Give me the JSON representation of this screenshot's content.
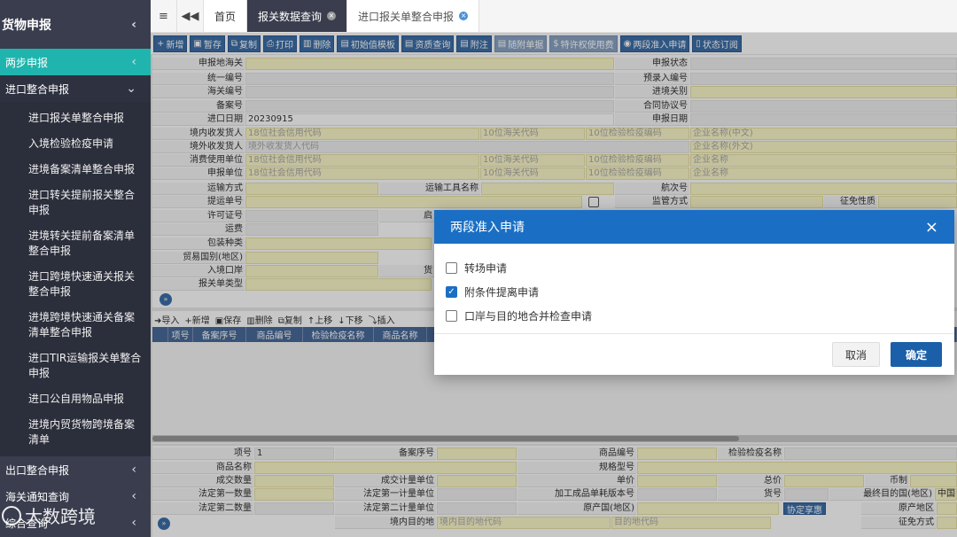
{
  "sidebar": {
    "title": "货物申报",
    "active": "两步申报",
    "open_group": "进口整合申报",
    "items": [
      "进口报关单整合申报",
      "入境检验检疫申请",
      "进境备案清单整合申报",
      "进口转关提前报关整合申报",
      "进境转关提前备案清单整合申报",
      "进口跨境快速通关报关整合申报",
      "进境跨境快速通关备案清单整合申报",
      "进口TIR运输报关单整合申报",
      "进口公自用物品申报",
      "进境内贸货物跨境备案清单"
    ],
    "bottom_groups": [
      "出口整合申报",
      "海关通知查询",
      "综合查询"
    ]
  },
  "watermark": "大数跨境",
  "tabs": {
    "home": "首页",
    "tab1": "报关数据查询",
    "tab2": "进口报关单整合申报"
  },
  "toolbar": [
    "新增",
    "暂存",
    "复制",
    "打印",
    "删除",
    "初始值模板",
    "资质查询",
    "附注",
    "随附单据",
    "特许权使用费",
    "两段准入申请",
    "状态订阅"
  ],
  "form": {
    "shenbaodi_haiguan": "申报地海关",
    "shenbao_zhuangtai": "申报状态",
    "tongyi_bianhao": "统一编号",
    "yulu_bianhao": "预录入编号",
    "haiguan_bianhao": "海关编号",
    "jinjing_guanbie": "进境关别",
    "beian_hao": "备案号",
    "hetong_xieyi_hao": "合同协议号",
    "jinkou_riqi": "进口日期",
    "jinkou_riqi_value": "20230915",
    "shenbao_riqi": "申报日期",
    "jingnei_shoufahuoren": "境内收发货人",
    "jingwai_shoufahuoren": "境外收发货人",
    "xiaofei_shiyong_danwei": "消费使用单位",
    "shenbao_danwei": "申报单位",
    "ph_credit": "18位社会信用代码",
    "ph_customs": "10位海关代码",
    "ph_ciq": "10位检验检疫编码",
    "ph_name_cn": "企业名称(中文)",
    "ph_foreign_code": "境外收发货人代码",
    "ph_name_en": "企业名称(外文)",
    "ph_name": "企业名称",
    "yunshu_fangshi": "运输方式",
    "yunshu_gongju_mingcheng": "运输工具名称",
    "hangci_hao": "航次号",
    "tiyun_danhao": "提运单号",
    "jianguan_fangshi": "监管方式",
    "zhengmian_xingzhi": "征免性质",
    "xuke_zhenghao": "许可证号",
    "qiyun": "启",
    "yunfei": "运费",
    "baozhuang_zhonglei": "包装种类",
    "maoyi_guobie": "贸易国别(地区)",
    "rujing_kouan": "入境口岸",
    "huo": "货",
    "baoguandan_leixing": "报关单类型"
  },
  "goods": {
    "toolbar": [
      "导入",
      "新增",
      "保存",
      "删除",
      "复制",
      "上移",
      "下移",
      "插入"
    ],
    "columns": [
      "项号",
      "备案序号",
      "商品编号",
      "检验检疫名称",
      "商品名称"
    ]
  },
  "item": {
    "xianghao": "项号",
    "xianghao_value": "1",
    "beian_xuhao": "备案序号",
    "shangpin_bianhao": "商品编号",
    "jianyan_mingcheng": "检验检疫名称",
    "shangpin_mingcheng": "商品名称",
    "guige_xinghao": "规格型号",
    "chengjiao_shuliang": "成交数量",
    "chengjiao_danwei": "成交计量单位",
    "danjia": "单价",
    "zongjia": "总价",
    "bizhi": "币制",
    "fading_diyi_shuliang": "法定第一数量",
    "fading_diyi_danwei": "法定第一计量单位",
    "jiagong_banben": "加工成品单耗版本号",
    "huohao": "货号",
    "zuizhong_mudi_guo": "最终目的国(地区)",
    "zuizhong_value": "中国",
    "fading_dier_shuliang": "法定第二数量",
    "fading_dier_danwei": "法定第二计量单位",
    "yuanchan_guo": "原产国(地区)",
    "xieding_xiangshou": "协定享惠",
    "yuanchan_diqu": "原产地区",
    "jingnei_mudidi": "境内目的地",
    "ph_dest_code": "境内目的地代码",
    "ph_dest_name": "目的地代码",
    "zhengmian_fangshi": "征免方式"
  },
  "modal": {
    "title": "两段准入申请",
    "options": [
      {
        "label": "转场申请",
        "checked": false
      },
      {
        "label": "附条件提离申请",
        "checked": true
      },
      {
        "label": "口岸与目的地合并检查申请",
        "checked": false
      }
    ],
    "cancel": "取消",
    "confirm": "确定"
  }
}
